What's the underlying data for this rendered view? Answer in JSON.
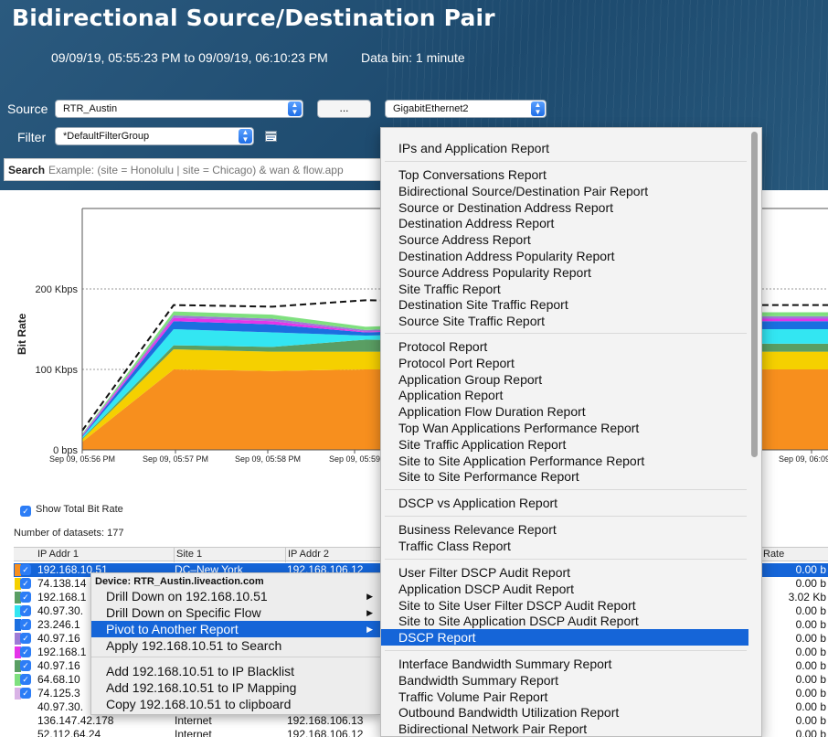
{
  "header": {
    "title": "Bidirectional Source/Destination Pair",
    "time_range": "09/09/19, 05:55:23 PM to 09/09/19, 06:10:23 PM",
    "data_bin": "Data bin: 1 minute"
  },
  "controls": {
    "source_label": "Source",
    "source_value": "RTR_Austin",
    "more_button": "...",
    "interface_value": "GigabitEthernet2",
    "filter_label": "Filter",
    "filter_value": "*DefaultFilterGroup",
    "search_label": "Search",
    "search_placeholder": "Example: (site = Honolulu | site = Chicago) & wan & flow.app"
  },
  "chart_data": {
    "type": "area",
    "ylabel": "Bit Rate",
    "y_ticks": [
      "0 bps",
      "100 Kbps",
      "200 Kbps"
    ],
    "ylim_kbps": [
      0,
      300
    ],
    "x_ticks": [
      "Sep 09, 05:56 PM",
      "Sep 09, 05:57 PM",
      "Sep 09, 05:58 PM",
      "Sep 09, 05:59",
      "Sep 09, 06:09 PM"
    ],
    "x": [
      "05:56",
      "05:57",
      "05:58",
      "05:59",
      "06:09",
      "06:10"
    ],
    "series": [
      {
        "color": "#f78f1e",
        "values": [
          10,
          100,
          98,
          100,
          100,
          100
        ]
      },
      {
        "color": "#f5d000",
        "values": [
          3,
          25,
          24,
          22,
          22,
          22
        ]
      },
      {
        "color": "#5a9e63",
        "values": [
          1,
          5,
          6,
          15,
          10,
          10
        ]
      },
      {
        "color": "#33e6f2",
        "values": [
          2,
          20,
          18,
          5,
          18,
          18
        ]
      },
      {
        "color": "#1b6fe0",
        "values": [
          1,
          10,
          10,
          4,
          10,
          10
        ]
      },
      {
        "color": "#e534e9",
        "values": [
          1,
          4,
          4,
          1,
          3,
          3
        ]
      },
      {
        "color": "#9e7bd6",
        "values": [
          1,
          3,
          3,
          2,
          3,
          3
        ]
      },
      {
        "color": "#7fe07f",
        "values": [
          1,
          5,
          5,
          4,
          5,
          5
        ]
      }
    ],
    "total_line": [
      24,
      180,
      178,
      186,
      180,
      180
    ],
    "grid": true,
    "total_line_style": "dashed black"
  },
  "options": {
    "show_total_label": "Show Total Bit Rate",
    "datasets_label": "Number of datasets: 177"
  },
  "table": {
    "columns": [
      "IP Addr 1",
      "Site 1",
      "IP Addr 2",
      "Rate"
    ],
    "rows": [
      {
        "color": "#f78f1e",
        "ip1": "192.168.10.51",
        "site1": "DC–New York",
        "ip2": "192.168.106.12",
        "rate": "0.00 b",
        "selected": true,
        "checked": true
      },
      {
        "color": "#f5d000",
        "ip1": "74.138.14",
        "site1": "",
        "ip2": "",
        "rate": "0.00 b",
        "checked": true
      },
      {
        "color": "#5a9e63",
        "ip1": "192.168.1",
        "site1": "",
        "ip2": "",
        "rate": "3.02 Kb",
        "checked": true
      },
      {
        "color": "#33e6f2",
        "ip1": "40.97.30.",
        "site1": "",
        "ip2": "",
        "rate": "0.00 b",
        "checked": true
      },
      {
        "color": "#1b6fe0",
        "ip1": "23.246.1",
        "site1": "",
        "ip2": "",
        "rate": "0.00 b",
        "checked": true
      },
      {
        "color": "#9e7bd6",
        "ip1": "40.97.16",
        "site1": "",
        "ip2": "",
        "rate": "0.00 b",
        "checked": true
      },
      {
        "color": "#e534e9",
        "ip1": "192.168.1",
        "site1": "",
        "ip2": "",
        "rate": "0.00 b",
        "checked": true
      },
      {
        "color": "#5a9e63",
        "ip1": "40.97.16",
        "site1": "",
        "ip2": "",
        "rate": "0.00 b",
        "checked": true
      },
      {
        "color": "#7fe07f",
        "ip1": "64.68.10",
        "site1": "",
        "ip2": "",
        "rate": "0.00 b",
        "checked": true
      },
      {
        "color": "#d9b3e6",
        "ip1": "74.125.3",
        "site1": "",
        "ip2": "",
        "rate": "0.00 b",
        "checked": true
      },
      {
        "color": "",
        "ip1": "40.97.30.",
        "site1": "",
        "ip2": "",
        "rate": "0.00 b",
        "checked": false
      },
      {
        "color": "",
        "ip1": "136.147.42.178",
        "site1": "Internet",
        "ip2": "192.168.106.13",
        "rate": "0.00 b",
        "checked": false
      },
      {
        "color": "",
        "ip1": "52.112.64.24",
        "site1": "Internet",
        "ip2": "192.168.106.12",
        "rate": "0.00 b",
        "checked": false
      }
    ]
  },
  "context_menu": {
    "device": "Device: RTR_Austin.liveaction.com",
    "items": [
      {
        "label": "Drill Down on 192.168.10.51",
        "submenu": true
      },
      {
        "label": "Drill Down on Specific Flow",
        "submenu": true
      },
      {
        "label": "Pivot to Another Report",
        "submenu": true,
        "highlighted": true
      },
      {
        "label": "Apply 192.168.10.51 to Search"
      },
      {
        "label": "Add 192.168.10.51 to IP Blacklist"
      },
      {
        "label": "Add 192.168.10.51 to IP Mapping"
      },
      {
        "label": "Copy 192.168.10.51 to clipboard"
      }
    ]
  },
  "report_menu": {
    "groups": [
      [
        "IPs and Application Report"
      ],
      [
        "Top Conversations Report",
        "Bidirectional Source/Destination Pair Report",
        "Source or Destination Address Report",
        "Destination Address Report",
        "Source Address Report",
        "Destination Address Popularity Report",
        "Source Address Popularity Report",
        "Site Traffic Report",
        "Destination Site Traffic Report",
        "Source Site Traffic Report"
      ],
      [
        "Protocol Report",
        "Protocol Port Report",
        "Application Group Report",
        "Application Report",
        "Application Flow Duration Report",
        "Top Wan Applications Performance Report",
        "Site Traffic Application Report",
        "Site to Site Application Performance Report",
        "Site to Site Performance Report"
      ],
      [
        "DSCP vs Application Report"
      ],
      [
        "Business Relevance Report",
        "Traffic Class Report"
      ],
      [
        "User Filter DSCP Audit Report",
        "Application DSCP Audit Report",
        "Site to Site User Filter DSCP Audit Report",
        "Site to Site Application DSCP Audit Report",
        "DSCP Report"
      ],
      [
        "Interface Bandwidth Summary Report",
        "Bandwidth Summary Report",
        "Traffic Volume Pair Report",
        "Outbound Bandwidth Utilization Report",
        "Bidirectional Network Pair Report",
        "Source or Destination Network Report"
      ]
    ],
    "highlighted": "DSCP Report"
  }
}
